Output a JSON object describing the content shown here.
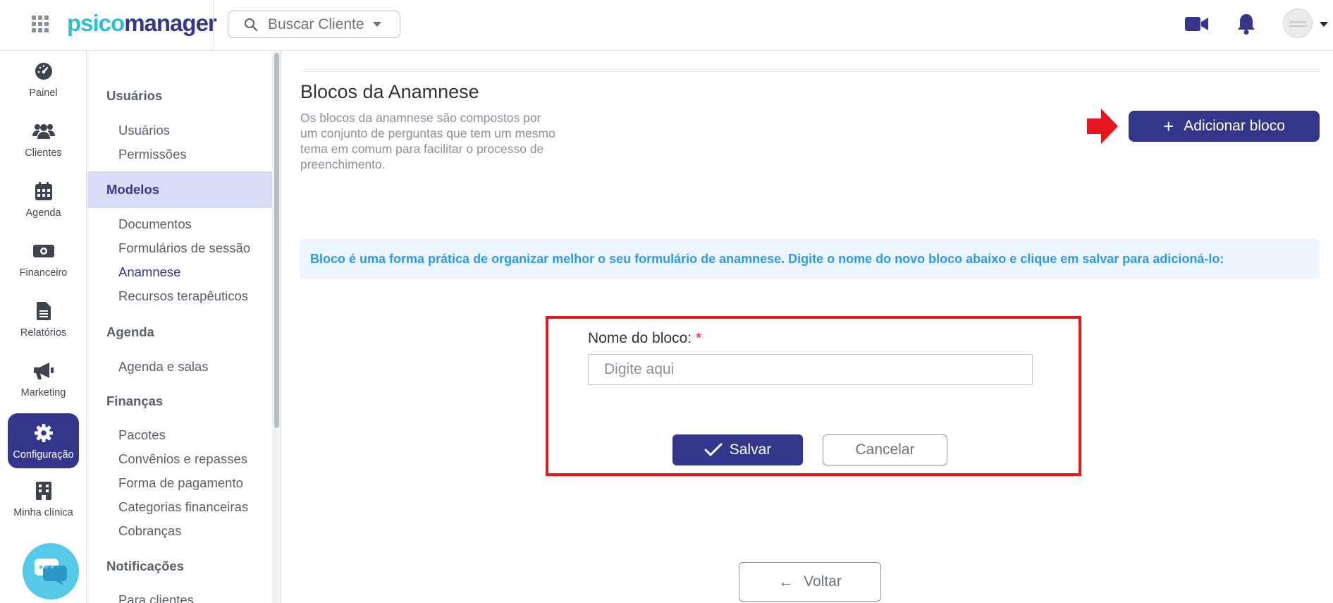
{
  "header": {
    "logo_part1": "psico",
    "logo_part2": "manager",
    "search_label": "Buscar Cliente"
  },
  "rail": {
    "items": [
      {
        "label": "Painel",
        "icon": "gauge-icon"
      },
      {
        "label": "Clientes",
        "icon": "users-icon"
      },
      {
        "label": "Agenda",
        "icon": "calendar-icon"
      },
      {
        "label": "Financeiro",
        "icon": "money-icon"
      },
      {
        "label": "Relatórios",
        "icon": "document-icon"
      },
      {
        "label": "Marketing",
        "icon": "megaphone-icon"
      },
      {
        "label": "Configuração",
        "icon": "gear-icon",
        "active": true
      },
      {
        "label": "Minha clínica",
        "icon": "building-icon"
      }
    ]
  },
  "submenu": {
    "usuarios": {
      "title": "Usuários",
      "items": [
        "Usuários",
        "Permissões"
      ]
    },
    "modelos": {
      "title": "Modelos",
      "items": [
        "Documentos",
        "Formulários de sessão",
        "Anamnese",
        "Recursos terapêuticos"
      ],
      "current": "Anamnese"
    },
    "agenda": {
      "title": "Agenda",
      "items": [
        "Agenda e salas"
      ]
    },
    "financas": {
      "title": "Finanças",
      "items": [
        "Pacotes",
        "Convênios e repasses",
        "Forma de pagamento",
        "Categorias financeiras",
        "Cobranças"
      ]
    },
    "notificacoes": {
      "title": "Notificações",
      "items": [
        "Para clientes"
      ]
    }
  },
  "main": {
    "title": "Blocos da Anamnese",
    "description": "Os blocos da anamnese são compostos por um conjunto de perguntas que tem um mesmo tema em comum para facilitar o processo de preenchimento.",
    "add_button": "Adicionar bloco",
    "info": "Bloco é uma forma prática de organizar melhor o seu formulário de anamnese. Digite o nome do novo bloco abaixo e clique em salvar para adicioná-lo:",
    "form": {
      "label": "Nome do bloco:",
      "required_mark": "*",
      "placeholder": "Digite aqui",
      "value": "",
      "save": "Salvar",
      "cancel": "Cancelar"
    },
    "back_button": "Voltar"
  },
  "colors": {
    "primary": "#33368a",
    "accent": "#2bbfd6",
    "highlight": "#e4161e",
    "info_text": "#2e9ae5"
  }
}
